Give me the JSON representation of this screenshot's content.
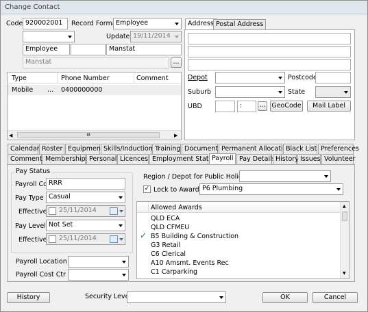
{
  "window": {
    "title": "Change Contact"
  },
  "top": {
    "code_label": "Code",
    "code_value": "920002001",
    "record_format_label": "Record Format",
    "record_format_value": "Employee",
    "small_dropdown_value": "",
    "updated_label": "Updated",
    "updated_value": "19/11/2014",
    "row3_field1": "Employee",
    "row3_field2": "",
    "row3_field3": "Manstat",
    "row4_value": "Manstat",
    "browse_label": "..."
  },
  "address_tabs": [
    "Address",
    "Postal Address"
  ],
  "address": {
    "depot_label": "Depot",
    "postcode_label": "Postcode",
    "suburb_label": "Suburb",
    "state_label": "State",
    "ubd_label": "UBD",
    "ubd_sep": ":",
    "browse_label": "...",
    "geocode_label": "GeoCode",
    "mail_label_label": "Mail Label"
  },
  "phones": {
    "headers": [
      "Type",
      "Phone Number",
      "Comment"
    ],
    "rows": [
      {
        "type": "Mobile",
        "dots": "...",
        "number": "0400000000",
        "comment": ""
      }
    ],
    "scroll_grip": "III"
  },
  "tabs_row1": [
    "Calendar",
    "Roster",
    "Equipment",
    "Skills/Inductions",
    "Training",
    "Documents",
    "Permanent Allocations",
    "Black List",
    "Preferences"
  ],
  "tabs_row2": [
    "Comments",
    "Memberships",
    "Personal",
    "Licences",
    "Employment Status",
    "Payroll",
    "Pay Details",
    "History",
    "Issues",
    "Volunteer"
  ],
  "payroll": {
    "pay_status_title": "Pay Status",
    "payroll_code_label": "Payroll Code",
    "payroll_code_value": "RRR",
    "pay_type_label": "Pay Type",
    "pay_type_value": "Casual",
    "effective_label": "Effective",
    "effective1_value": "25/11/2014",
    "pay_level_label": "Pay Level",
    "pay_level_value": "Not Set",
    "effective2_value": "25/11/2014",
    "payroll_location_label": "Payroll Location",
    "payroll_cost_ctr_label": "Payroll Cost Ctr",
    "region_label": "Region / Depot for Public Holidays",
    "lock_label": "Lock to Award",
    "lock_checked": true,
    "award_value": "P6 Plumbing",
    "allowed_header": "Allowed Awards",
    "awards": [
      {
        "name": "QLD ECA",
        "checked": false
      },
      {
        "name": "QLD CFMEU",
        "checked": false
      },
      {
        "name": "B5 Building & Construction",
        "checked": true
      },
      {
        "name": "G3 Retail",
        "checked": false
      },
      {
        "name": "C6 Clerical",
        "checked": false
      },
      {
        "name": "A10 Amsmt. Events Rec",
        "checked": false
      },
      {
        "name": "C1 Carparking",
        "checked": false
      }
    ]
  },
  "bottom": {
    "history_label": "History",
    "security_level_label": "Security Level",
    "ok_label": "OK",
    "cancel_label": "Cancel"
  },
  "colors": {
    "title_bg": "#dfe6ee",
    "dialog_bg": "#f0f0f0",
    "accent_check": "#2a8a2a"
  }
}
